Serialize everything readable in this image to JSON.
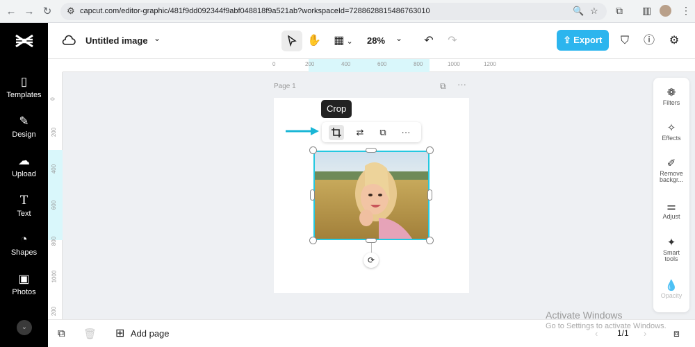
{
  "browser": {
    "url": "capcut.com/editor-graphic/481f9dd092344f9abf048818f9a521ab?workspaceId=7288628815486763010"
  },
  "sidebar": {
    "items": [
      {
        "label": "Templates",
        "icon": "templates-icon"
      },
      {
        "label": "Design",
        "icon": "design-icon"
      },
      {
        "label": "Upload",
        "icon": "upload-icon"
      },
      {
        "label": "Text",
        "icon": "text-icon"
      },
      {
        "label": "Shapes",
        "icon": "shapes-icon"
      },
      {
        "label": "Photos",
        "icon": "photos-icon"
      }
    ]
  },
  "topbar": {
    "title": "Untitled image",
    "zoom": "28%",
    "export_label": "Export"
  },
  "ruler": {
    "top_ticks": [
      "0",
      "200",
      "400",
      "600",
      "800",
      "1000",
      "1200"
    ],
    "left_ticks": [
      "0",
      "200",
      "400",
      "600",
      "800",
      "1000",
      "200"
    ]
  },
  "canvas": {
    "page_label": "Page 1",
    "tooltip": "Crop"
  },
  "right_panel": {
    "items": [
      {
        "label": "Filters"
      },
      {
        "label": "Effects"
      },
      {
        "label": "Remove backgr..."
      },
      {
        "label": "Adjust"
      },
      {
        "label": "Smart tools"
      },
      {
        "label": "Opacity"
      }
    ]
  },
  "bottom": {
    "add_page_label": "Add page",
    "page_counter": "1/1"
  },
  "watermark": {
    "line1": "Activate Windows",
    "line2": "Go to Settings to activate Windows."
  },
  "colors": {
    "accent": "#2cb5ee",
    "selection": "#25c8e0",
    "sidebar_bg": "#000000"
  }
}
